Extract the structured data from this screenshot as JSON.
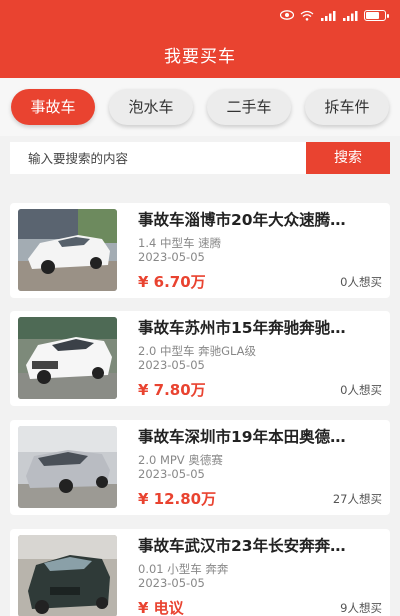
{
  "header": {
    "title": "我要买车"
  },
  "status": {
    "battery": 0.7
  },
  "categories": [
    {
      "label": "事故车",
      "active": true
    },
    {
      "label": "泡水车",
      "active": false
    },
    {
      "label": "二手车",
      "active": false
    },
    {
      "label": "拆车件",
      "active": false
    }
  ],
  "search": {
    "placeholder": "输入要搜索的内容",
    "button": "搜索"
  },
  "listings": [
    {
      "title": "事故车淄博市20年大众速腾…",
      "spec": "1.4 中型车 速腾",
      "date": "2023-05-05",
      "price": "¥ 6.70万",
      "want": "0人想买",
      "car_color": "#f4f4f4"
    },
    {
      "title": "事故车苏州市15年奔驰奔驰…",
      "spec": "2.0 中型车 奔驰GLA级",
      "date": "2023-05-05",
      "price": "¥ 7.80万",
      "want": "0人想买",
      "car_color": "#f6f6f6"
    },
    {
      "title": "事故车深圳市19年本田奥德…",
      "spec": "2.0 MPV 奥德赛",
      "date": "2023-05-05",
      "price": "¥ 12.80万",
      "want": "27人想买",
      "car_color": "#b9bcc2"
    },
    {
      "title": "事故车武汉市23年长安奔奔…",
      "spec": "0.01 小型车 奔奔",
      "date": "2023-05-05",
      "price": "¥ 电议",
      "want": "9人想买",
      "car_color": "#2f3a38"
    }
  ],
  "colors": {
    "accent": "#e94330"
  }
}
